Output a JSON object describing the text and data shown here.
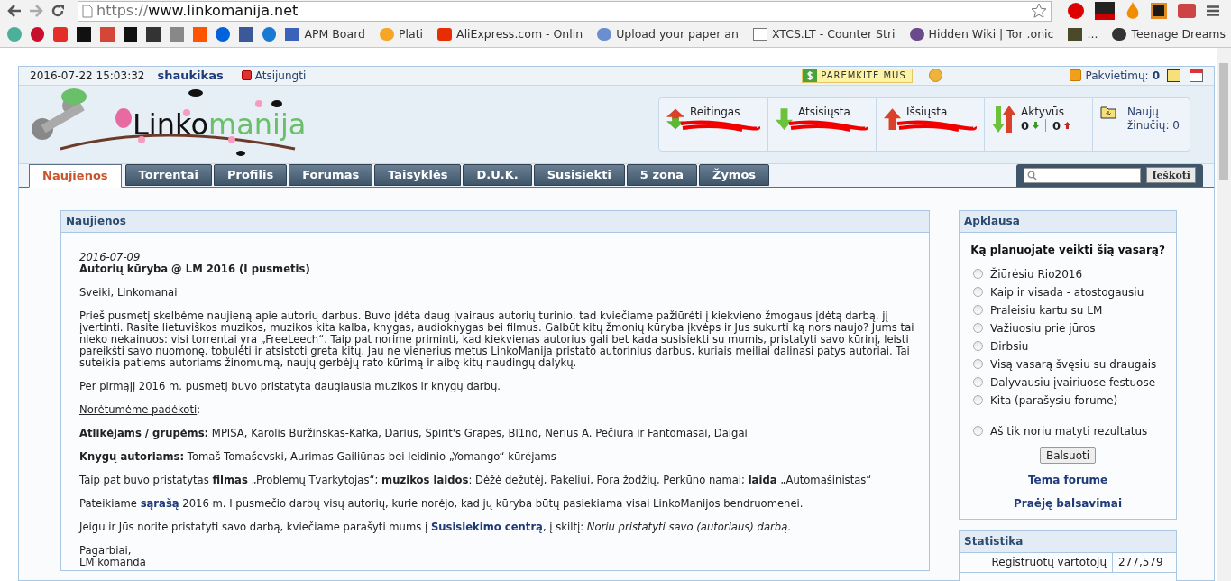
{
  "browser": {
    "url_scheme": "https://",
    "url_host": "www.linkomanija.net",
    "bookmarks": [
      {
        "label": "APM Board"
      },
      {
        "label": "Plati"
      },
      {
        "label": "AliExpress.com - Onlin"
      },
      {
        "label": "Upload your paper an"
      },
      {
        "label": "XTCS.LT - Counter Stri"
      },
      {
        "label": "Hidden Wiki | Tor .onic"
      },
      {
        "label": "..."
      },
      {
        "label": "Teenage Dreams"
      }
    ]
  },
  "topbar": {
    "datetime": "2016-07-22 15:03:32",
    "username": "shaukikas",
    "logout": "Atsijungti",
    "donate": "PAREMKITE MUS",
    "invites_label": "Pakvietimų:",
    "invites_count": "0"
  },
  "logo": {
    "part1": "Linko",
    "part2": "manija"
  },
  "stats": [
    {
      "kind": "rating",
      "label": "Reitingas",
      "redacted": true
    },
    {
      "kind": "down",
      "label": "Atsisiųsta",
      "redacted": true
    },
    {
      "kind": "up",
      "label": "Išsiųsta",
      "redacted": true
    },
    {
      "kind": "active",
      "label": "Aktyvūs",
      "down": "0",
      "up": "0"
    },
    {
      "kind": "messages",
      "label": "Naujų",
      "label2": "žinučių: 0"
    }
  ],
  "tabs": [
    {
      "label": "Naujienos",
      "selected": true
    },
    {
      "label": "Torrentai",
      "selected": false
    },
    {
      "label": "Profilis",
      "selected": false
    },
    {
      "label": "Forumas",
      "selected": false
    },
    {
      "label": "Taisyklės",
      "selected": false
    },
    {
      "label": "D.U.K.",
      "selected": false
    },
    {
      "label": "Susisiekti",
      "selected": false
    },
    {
      "label": "5 zona",
      "selected": false
    },
    {
      "label": "Žymos",
      "selected": false
    }
  ],
  "search": {
    "button": "Ieškoti"
  },
  "news": {
    "title": "Naujienos",
    "date": "2016-07-09",
    "headline": "Autorių kūryba @ LM 2016 (I pusmetis)",
    "paragraphs": [
      [
        {
          "kind": "text",
          "text": "Sveiki, Linkomanai"
        }
      ],
      [
        {
          "kind": "text",
          "text": "Prieš pusmetį skelbėme naujieną apie autorių darbus. Buvo įdėta daug įvairaus autorių turinio, tad kviečiame pažiūrėti į kiekvieno žmogaus įdėtą darbą, jį įvertinti. Rasite lietuviškos muzikos, muzikos kita kalba, knygas, audioknygas bei filmus. Galbūt kitų žmonių kūryba įkvėps ir Jus sukurti ką nors naujo? Jums tai nieko nekainuos: visi torrentai yra „FreeLeech“. Taip pat norime priminti, kad kiekvienas autorius gali bet kada susisiekti su mumis, pristatyti savo kūrinį, leisti pareikšti savo nuomonę, tobulėti ir atsistoti greta kitų. Jau ne vienerius metus LinkoManija pristato autorinius darbus, kuriais meiliai dalinasi patys autoriai. Tai suteikia patiems autoriams žinomumą, naujų gerbėjų rato kūrimą ir aibę kitų naudingų dalykų."
        }
      ],
      [
        {
          "kind": "text",
          "text": "Per pirmąjį 2016 m. pusmetį buvo pristatyta daugiausia muzikos ir knygų darbų."
        }
      ],
      [
        {
          "kind": "underlined",
          "text": "Norėtumėme padėkoti"
        },
        {
          "kind": "text",
          "text": ":"
        }
      ],
      [
        {
          "kind": "text",
          "text": "**Atlikėjams / grupėms:** MPISA, Karolis Buržinskas-Kafka, Darius, Spirit's Grapes, Bl1nd, Nerius A. Pečiūra ir Fantomasai, Daigai"
        }
      ],
      [
        {
          "kind": "text",
          "text": "**Knygų autoriams:** Tomaš Tomaševski, Aurimas Gailiūnas bei leidinio „Yomango“ kūrėjams"
        }
      ],
      [
        {
          "kind": "text",
          "text": "Taip pat buvo pristatytas **filmas** „Problemų Tvarkytojas“; **muzikos laidos**: Dėžė dežutėj, Pakeliui, Pora žodžių, Perkūno namai; **laida** „Automašinistas“"
        }
      ],
      [
        {
          "kind": "text",
          "text": "Pateikiame "
        },
        {
          "kind": "link",
          "text": "sąrašą"
        },
        {
          "kind": "text",
          "text": " 2016 m. I pusmečio darbų visų autorių, kurie norėjo, kad jų kūryba būtų pasiekiama visai LinkoManijos bendruomenei."
        }
      ],
      [
        {
          "kind": "text",
          "text": "Jeigu ir Jūs norite pristatyti savo darbą, kviečiame parašyti mums į "
        },
        {
          "kind": "link",
          "text": "Susisiekimo centrą"
        },
        {
          "kind": "text",
          "text": ", į skiltį: *Noriu pristatyti savo (autoriaus) darbą*."
        }
      ],
      [
        {
          "kind": "text",
          "text": "Pagarbiai,"
        },
        {
          "kind": "break"
        },
        {
          "kind": "text",
          "text": "LM komanda"
        }
      ]
    ]
  },
  "poll": {
    "title": "Apklausa",
    "question": "Ką planuojate veikti šią vasarą?",
    "options": [
      {
        "label": "Žiūrėsiu Rio2016",
        "selected": false
      },
      {
        "label": "Kaip ir visada - atostogausiu",
        "selected": false
      },
      {
        "label": "Praleisiu kartu su LM",
        "selected": false
      },
      {
        "label": "Važiuosiu prie jūros",
        "selected": false
      },
      {
        "label": "Dirbsiu",
        "selected": false
      },
      {
        "label": "Visą vasarą švęsiu su draugais",
        "selected": false
      },
      {
        "label": "Dalyvausiu įvairiuose festuose",
        "selected": false
      },
      {
        "label": "Kita (parašysiu forume)",
        "selected": false
      }
    ],
    "results_option": {
      "label": "Aš tik noriu matyti rezultatus",
      "selected": false
    },
    "vote": "Balsuoti",
    "links": [
      "Tema forume",
      "Praėję balsavimai"
    ]
  },
  "statistics": {
    "title": "Statistika",
    "rows": [
      {
        "label": "Registruotų vartotojų",
        "value": "277,579"
      }
    ]
  }
}
